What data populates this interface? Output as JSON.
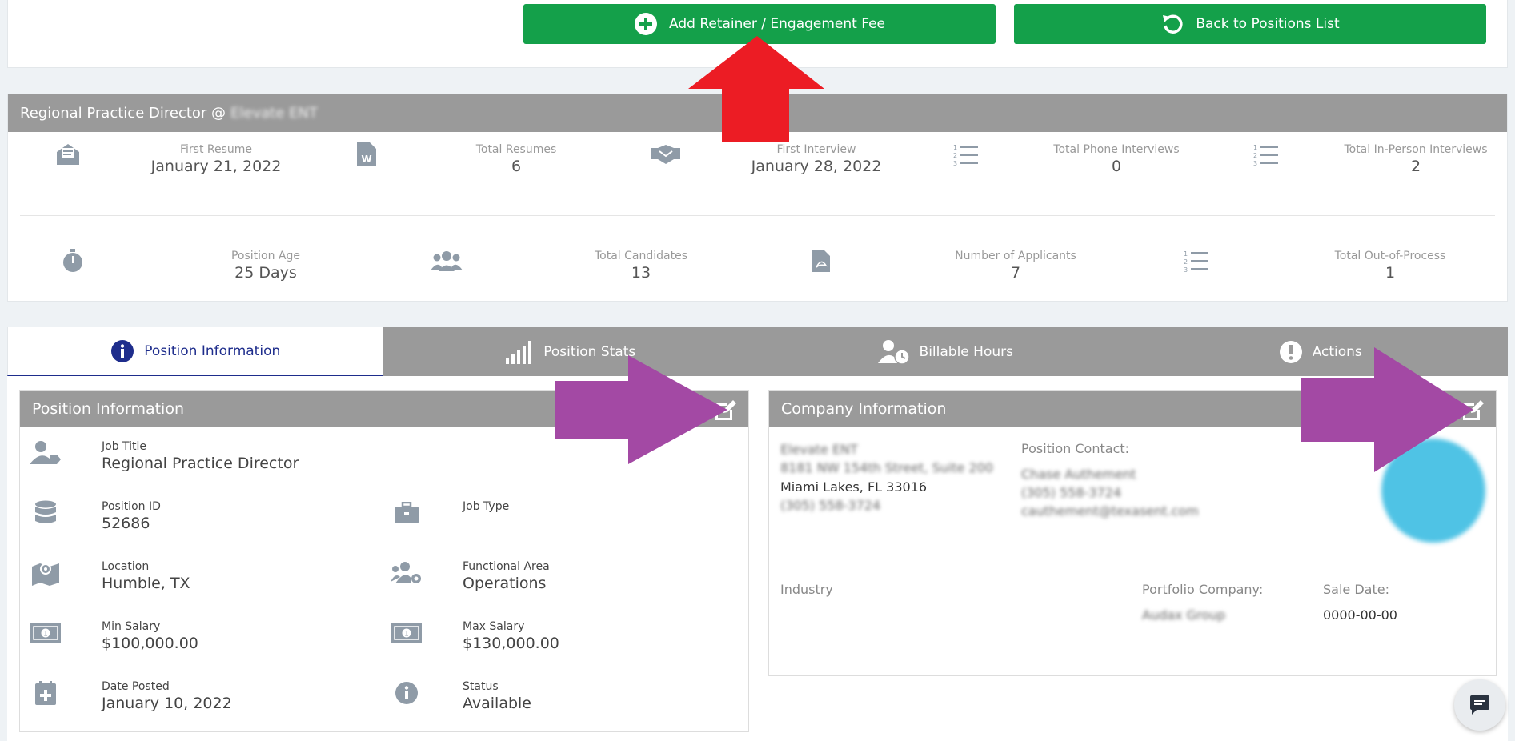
{
  "actions": {
    "add_retainer_label": "Add Retainer / Engagement Fee",
    "back_label": "Back to Positions List"
  },
  "stats": {
    "title": "Regional Practice Director @",
    "company_blurred": "Elevate ENT",
    "row1": [
      {
        "icon": "resume-envelope-icon",
        "label": "First Resume",
        "value": "January 21, 2022"
      },
      {
        "icon": "word-file-icon",
        "label": "Total Resumes",
        "value": "6"
      },
      {
        "icon": "handshake-icon",
        "label": "First Interview",
        "value": "January 28, 2022"
      },
      {
        "icon": "numbered-list-icon",
        "label": "Total Phone Interviews",
        "value": "0"
      },
      {
        "icon": "numbered-list-icon",
        "label": "Total In-Person Interviews",
        "value": "2"
      }
    ],
    "row2": [
      {
        "icon": "stopwatch-icon",
        "label": "Position Age",
        "value": "25 Days"
      },
      {
        "icon": "users-icon",
        "label": "Total Candidates",
        "value": "13"
      },
      {
        "icon": "pdf-file-icon",
        "label": "Number of Applicants",
        "value": "7"
      },
      {
        "icon": "numbered-list-icon",
        "label": "Total Out-of-Process",
        "value": "1"
      }
    ]
  },
  "tabs": [
    {
      "label": "Position Information",
      "icon": "info-circle-icon",
      "active": true
    },
    {
      "label": "Position Stats",
      "icon": "signal-bars-icon",
      "active": false
    },
    {
      "label": "Billable Hours",
      "icon": "user-clock-icon",
      "active": false
    },
    {
      "label": "Actions",
      "icon": "exclamation-circle-icon",
      "active": false
    }
  ],
  "position_info": {
    "title": "Position Information",
    "job_title_label": "Job Title",
    "job_title": "Regional Practice Director",
    "position_id_label": "Position ID",
    "position_id": "52686",
    "job_type_label": "Job Type",
    "job_type": "",
    "location_label": "Location",
    "location": "Humble, TX",
    "functional_area_label": "Functional Area",
    "functional_area": "Operations",
    "min_salary_label": "Min Salary",
    "min_salary": "$100,000.00",
    "max_salary_label": "Max Salary",
    "max_salary": "$130,000.00",
    "date_posted_label": "Date Posted",
    "date_posted": "January 10, 2022",
    "status_label": "Status",
    "status": "Available"
  },
  "company_info": {
    "title": "Company Information",
    "name_blurred": "Elevate ENT",
    "address_blurred": "8181 NW 154th Street, Suite 200",
    "city": "Miami Lakes, FL 33016",
    "phone_blurred": "(305) 558-3724",
    "contact_label": "Position Contact:",
    "contact_name_blurred": "Chase Authement",
    "contact_phone_blurred": "(305) 558-3724",
    "contact_email_blurred": "cauthement@texasent.com",
    "industry_label": "Industry",
    "portfolio_label": "Portfolio Company:",
    "portfolio_blurred": "Audax Group",
    "sale_date_label": "Sale Date:",
    "sale_date": "0000-00-00"
  },
  "colors": {
    "green": "#14a04a",
    "header_gray": "#9a9a9a",
    "icon_gray": "#8f9ba7",
    "active_tab": "#1e2d8c",
    "annotation_red": "#ec1c24",
    "annotation_purple": "#a349a4"
  }
}
